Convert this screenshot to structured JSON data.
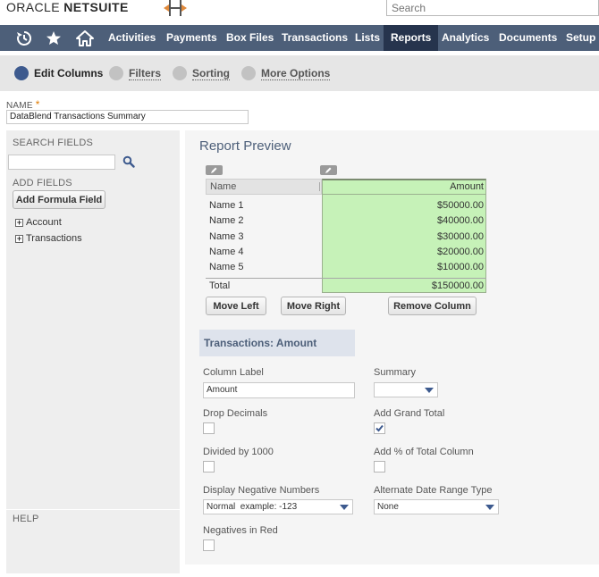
{
  "header": {
    "brand_prefix": "ORACLE",
    "brand_name": "NETSUITE",
    "search_placeholder": "Search"
  },
  "nav": {
    "icons": [
      "recent-icon",
      "star-icon",
      "home-icon"
    ],
    "items": [
      "Activities",
      "Payments",
      "Box Files",
      "Transactions",
      "Lists",
      "Reports",
      "Analytics",
      "Documents",
      "Setup"
    ],
    "active": "Reports"
  },
  "subtabs": [
    "Edit Columns",
    "Filters",
    "Sorting",
    "More Options"
  ],
  "name_field": {
    "label": "NAME",
    "required_mark": "*",
    "value": "DataBlend Transactions Summary"
  },
  "left": {
    "search_title": "SEARCH FIELDS",
    "add_fields_title": "ADD FIELDS",
    "add_formula_button": "Add Formula Field",
    "tree": [
      "Account",
      "Transactions"
    ],
    "help_title": "HELP"
  },
  "preview": {
    "title": "Report Preview",
    "columns": [
      "Name",
      "Amount"
    ],
    "rows": [
      {
        "name": "Name 1",
        "amount": "$50000.00"
      },
      {
        "name": "Name 2",
        "amount": "$40000.00"
      },
      {
        "name": "Name 3",
        "amount": "$30000.00"
      },
      {
        "name": "Name 4",
        "amount": "$20000.00"
      },
      {
        "name": "Name 5",
        "amount": "$10000.00"
      }
    ],
    "total_label": "Total",
    "total_value": "$150000.00",
    "buttons": [
      "Move Left",
      "Move Right",
      "Remove Column"
    ]
  },
  "column_settings": {
    "section_title": "Transactions: Amount",
    "column_label": {
      "label": "Column Label",
      "value": "Amount"
    },
    "summary": {
      "label": "Summary",
      "value": ""
    },
    "drop_decimals": {
      "label": "Drop Decimals",
      "checked": false
    },
    "add_grand_total": {
      "label": "Add Grand Total",
      "checked": true
    },
    "divided_by_1000": {
      "label": "Divided by 1000",
      "checked": false
    },
    "add_pct_total": {
      "label": "Add % of Total Column",
      "checked": false
    },
    "display_negative": {
      "label": "Display Negative Numbers",
      "value": "Normal  example: -123"
    },
    "alt_date_range": {
      "label": "Alternate Date Range Type",
      "value": "None"
    },
    "negatives_in_red": {
      "label": "Negatives in Red",
      "checked": false
    }
  },
  "colors": {
    "nav_bg": "#4d5f79",
    "nav_active": "#26344d",
    "selected_column": "#c6f2b8",
    "accent": "#3d5a8e"
  }
}
